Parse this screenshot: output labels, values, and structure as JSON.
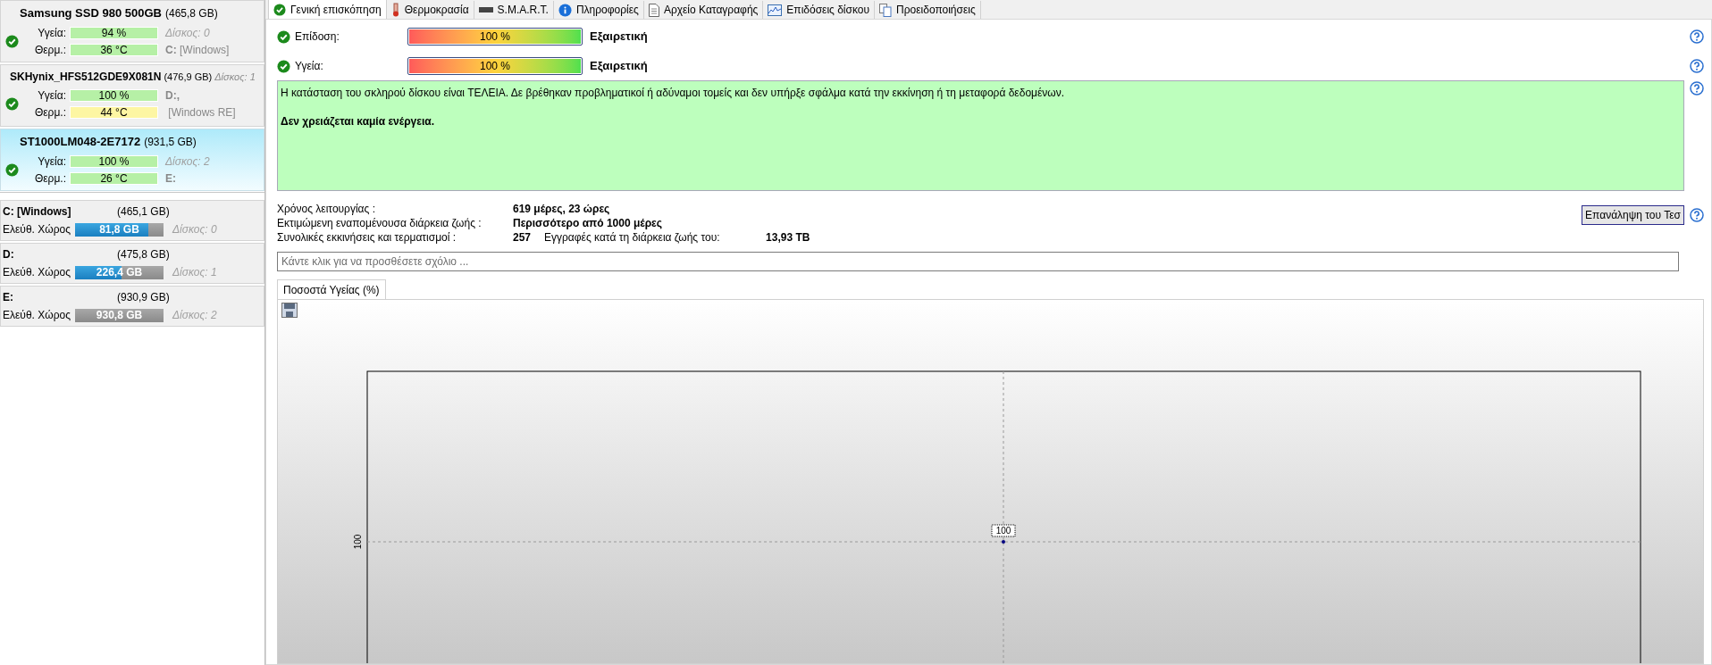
{
  "disks": [
    {
      "name": "Samsung SSD 980 500GB",
      "size": "(465,8 GB)",
      "selected": false,
      "ok": true,
      "rows": [
        {
          "label": "Υγεία:",
          "value": "94 %",
          "color": "#b6f0a6",
          "note": "Δίσκος: 0",
          "kind": "disk"
        },
        {
          "label": "Θερμ.:",
          "value": "36 °C",
          "color": "#b6f0a6",
          "note": "**C:** [Windows]",
          "kind": "volume"
        }
      ]
    },
    {
      "name": "SKHynix_HFS512GDE9X081N",
      "size": "(476,9 GB)",
      "extra": "Δίσκος: 1",
      "selected": false,
      "ok": true,
      "rows": [
        {
          "label": "Υγεία:",
          "value": "100 %",
          "color": "#b6f0a6",
          "note": "**D:,**",
          "kind": "volume"
        },
        {
          "label": "Θερμ.:",
          "value": "44 °C",
          "color": "#fdf6a3",
          "note": " [Windows RE]",
          "kind": "volume"
        }
      ]
    },
    {
      "name": "ST1000LM048-2E7172",
      "size": "(931,5 GB)",
      "selected": true,
      "ok": true,
      "rows": [
        {
          "label": "Υγεία:",
          "value": "100 %",
          "color": "#b6f0a6",
          "note": "Δίσκος: 2",
          "kind": "disk"
        },
        {
          "label": "Θερμ.:",
          "value": "26 °C",
          "color": "#b6f0a6",
          "note": "**E:**",
          "kind": "volume"
        }
      ]
    }
  ],
  "volumes": [
    {
      "name": "C: [Windows]",
      "size": "(465,1 GB)",
      "label": "Ελεύθ. Χώρος",
      "free": "81,8 GB",
      "level": 0.83,
      "disk": "Δίσκος: 0"
    },
    {
      "name": "D:",
      "size": "(475,8 GB)",
      "label": "Ελεύθ. Χώρος",
      "free": "226,4 GB",
      "level": 0.53,
      "disk": "Δίσκος: 1"
    },
    {
      "name": "E:",
      "size": "(930,9 GB)",
      "label": "Ελεύθ. Χώρος",
      "free": "930,8 GB",
      "level": 0,
      "disk": "Δίσκος: 2"
    }
  ],
  "tabs": [
    {
      "label": "Γενική επισκόπηση",
      "selected": true
    },
    {
      "label": "Θερμοκρασία",
      "selected": false
    },
    {
      "label": "S.M.A.R.T.",
      "selected": false
    },
    {
      "label": "Πληροφορίες",
      "selected": false
    },
    {
      "label": "Αρχείο Καταγραφής",
      "selected": false
    },
    {
      "label": "Επιδόσεις δίσκου",
      "selected": false
    },
    {
      "label": "Προειδοποιήσεις",
      "selected": false
    }
  ],
  "ratings": [
    {
      "label": "Επίδοση:",
      "value": "100 %",
      "level": 1,
      "verdict": "Εξαιρετική"
    },
    {
      "label": "Υγεία:",
      "value": "100 %",
      "level": 1,
      "verdict": "Εξαιρετική"
    }
  ],
  "status_message": {
    "text": "Η κατάσταση του σκληρού δίσκου είναι ΤΕΛΕΙΑ. Δε βρέθηκαν προβληματικοί ή αδύναμοι τομείς και δεν υπήρξε σφάλμα κατά την εκκίνηση ή τη μεταφορά δεδομένων.",
    "action": "Δεν χρειάζεται καμία ενέργεια."
  },
  "stats": [
    {
      "label": "Χρόνος λειτουργίας :",
      "value": "619 μέρες, 23 ώρες"
    },
    {
      "label": "Εκτιμώμενη εναπομένουσα διάρκεια ζωής :",
      "value": "Περισσότερο από 1000 μέρες"
    },
    {
      "label": "Συνολικές εκκινήσεις και τερματισμοί :",
      "value": "257",
      "extra_label": "Εγγραφές κατά τη διάρκεια ζωής του:",
      "extra_value": "13,93 TB"
    }
  ],
  "retest_button": "Επανάληψη του Τεσ",
  "comment_field": {
    "placeholder": "Κάντε κλικ για να προσθέσετε σχόλιο ..."
  },
  "chart_tab": {
    "label": "Ποσοστά Υγείας (%)",
    "selected": true
  },
  "chart": {
    "y_tick": "100",
    "point_label": "100"
  }
}
